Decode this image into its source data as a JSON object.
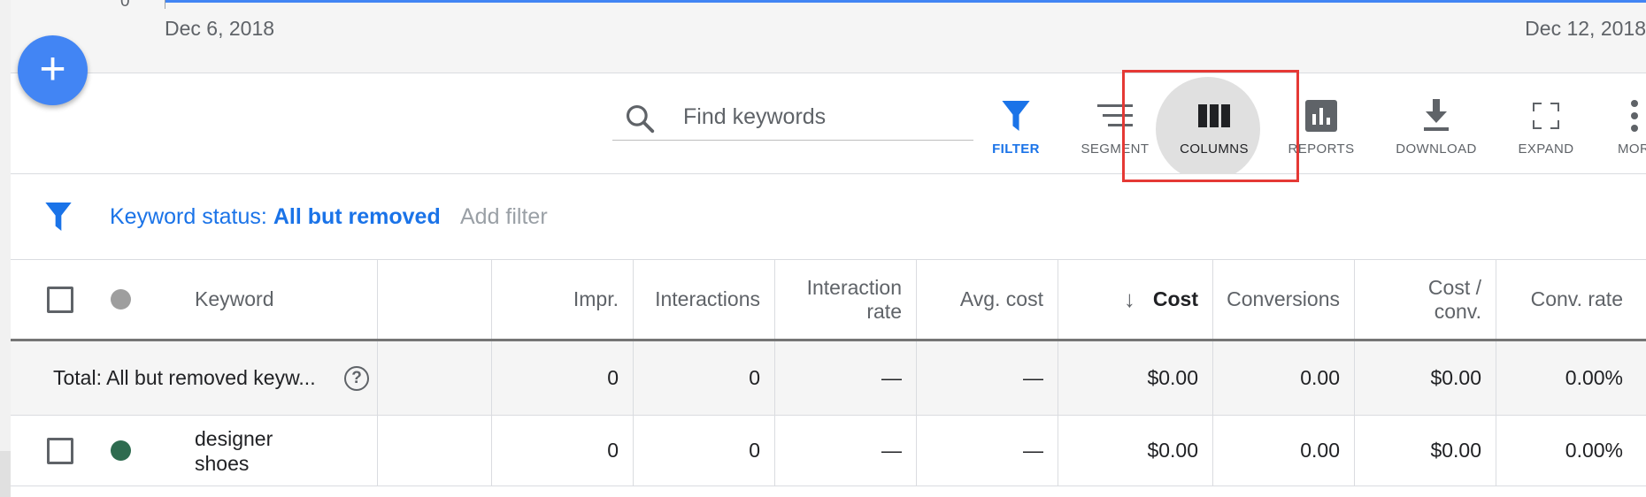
{
  "chart": {
    "y_zero": "0",
    "date_start": "Dec 6, 2018",
    "date_end": "Dec 12, 2018",
    "line_color": "#4285f4"
  },
  "fab": {
    "icon": "plus-icon",
    "label": "+"
  },
  "search": {
    "placeholder": "Find keywords",
    "icon": "search-icon"
  },
  "toolbar": {
    "filter": "FILTER",
    "segment": "SEGMENT",
    "columns": "COLUMNS",
    "reports": "REPORTS",
    "download": "DOWNLOAD",
    "expand": "EXPAND",
    "more": "MOR"
  },
  "filterbar": {
    "status_label": "Keyword status: ",
    "status_value": "All but removed",
    "add_filter": "Add filter"
  },
  "table": {
    "headers": {
      "keyword": "Keyword",
      "impr": "Impr.",
      "interactions": "Interactions",
      "interaction_rate": "Interaction rate",
      "avg_cost": "Avg. cost",
      "cost": "Cost",
      "conversions": "Conversions",
      "cost_conv": "Cost / conv.",
      "conv_rate": "Conv. rate"
    },
    "total": {
      "label": "Total: All but removed keyw...",
      "impr": "0",
      "interactions": "0",
      "interaction_rate": "—",
      "avg_cost": "—",
      "cost": "$0.00",
      "conversions": "0.00",
      "cost_conv": "$0.00",
      "conv_rate": "0.00%"
    },
    "rows": [
      {
        "keyword": "designer shoes",
        "status_color": "#2e6b4f",
        "impr": "0",
        "interactions": "0",
        "interaction_rate": "—",
        "avg_cost": "—",
        "cost": "$0.00",
        "conversions": "0.00",
        "cost_conv": "$0.00",
        "conv_rate": "0.00%"
      }
    ]
  },
  "colors": {
    "accent": "#1a73e8",
    "fab": "#4285f4",
    "highlight": "#e53935"
  }
}
